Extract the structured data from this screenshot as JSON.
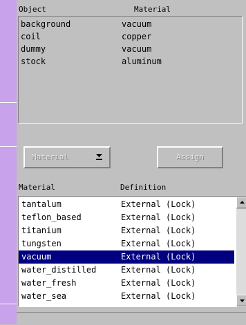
{
  "objects": {
    "col_object": "Object",
    "col_material": "Material",
    "rows": [
      {
        "object": "background",
        "material": "vacuum"
      },
      {
        "object": "coil",
        "material": "copper"
      },
      {
        "object": "dummy",
        "material": "vacuum"
      },
      {
        "object": "stock",
        "material": "aluminum"
      }
    ]
  },
  "buttons": {
    "material_label": "Material",
    "assign_label": "Assign"
  },
  "materials": {
    "col_material": "Material",
    "col_definition": "Definition",
    "selected_index": 4,
    "rows": [
      {
        "name": "tantalum",
        "definition": "External (Lock)"
      },
      {
        "name": "teflon_based",
        "definition": "External (Lock)"
      },
      {
        "name": "titanium",
        "definition": "External (Lock)"
      },
      {
        "name": "tungsten",
        "definition": "External (Lock)"
      },
      {
        "name": "vacuum",
        "definition": "External (Lock)"
      },
      {
        "name": "water_distilled",
        "definition": "External (Lock)"
      },
      {
        "name": "water_fresh",
        "definition": "External (Lock)"
      },
      {
        "name": "water_sea",
        "definition": "External (Lock)"
      }
    ]
  },
  "icons": {
    "material_button": "down-arrow-icon",
    "scroll_up": "scroll-up-arrow-icon",
    "scroll_down": "scroll-down-arrow-icon"
  },
  "colors": {
    "selection": "#000080",
    "left_rail": "#c9a2ec"
  }
}
